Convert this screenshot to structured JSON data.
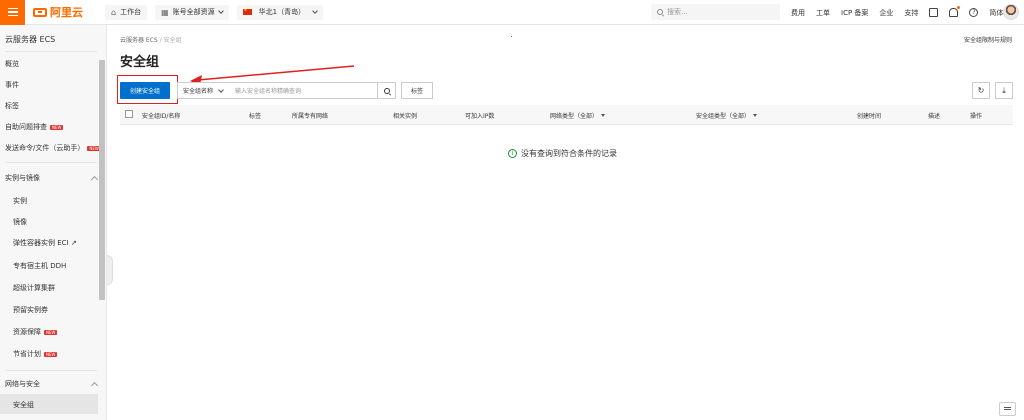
{
  "topbar": {
    "logo_text": "阿里云",
    "workbench": "工作台",
    "account_resources": "账号全部资源",
    "region": "华北1（青岛）",
    "search_placeholder": "搜索...",
    "links": [
      "费用",
      "工单",
      "ICP 备案",
      "企业",
      "支持"
    ],
    "language": "简体"
  },
  "sidebar": {
    "title": "云服务器 ECS",
    "items": [
      {
        "label": "概览"
      },
      {
        "label": "事件"
      },
      {
        "label": "标签"
      },
      {
        "label": "自助问题排查",
        "badge": "NEW"
      },
      {
        "label": "发送命令/文件（云助手）",
        "badge": "NEW"
      }
    ],
    "group_instances": {
      "label": "实例与镜像",
      "items": [
        {
          "label": "实例"
        },
        {
          "label": "镜像"
        },
        {
          "label": "弹性容器实例 ECI ↗"
        },
        {
          "label": "专有宿主机 DDH"
        },
        {
          "label": "超级计算集群"
        },
        {
          "label": "预留实例券"
        },
        {
          "label": "资源保障",
          "badge": "NEW"
        },
        {
          "label": "节省计划",
          "badge": "NEW"
        }
      ]
    },
    "group_network": {
      "label": "网络与安全",
      "items": [
        {
          "label": "安全组"
        }
      ]
    }
  },
  "main": {
    "breadcrumb": {
      "root": "云服务器 ECS",
      "sep": "/",
      "current": "安全组"
    },
    "header_link": "安全组限制与规则",
    "title": "安全组",
    "create_button": "创建安全组",
    "filter": {
      "select_label": "安全组名称",
      "input_placeholder": "输入安全组名称精确查询",
      "tag_button": "标签"
    },
    "columns": [
      "安全组ID/名称",
      "标签",
      "所属专有网络",
      "相关实例",
      "可加入IP数",
      "网络类型（全部）",
      "安全组类型（全部）",
      "创建时间",
      "描述",
      "操作"
    ],
    "empty_message": "没有查询到符合条件的记录"
  },
  "colors": {
    "brand": "#ff6a00",
    "primary": "#0070cc",
    "annotation": "#e02020",
    "info": "#1e8e3e"
  }
}
